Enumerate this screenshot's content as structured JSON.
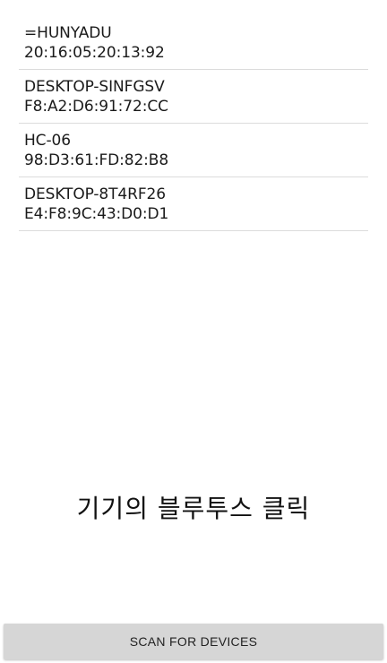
{
  "devices": [
    {
      "name": "=HUNYADU",
      "address": "20:16:05:20:13:92"
    },
    {
      "name": "DESKTOP-SINFGSV",
      "address": "F8:A2:D6:91:72:CC"
    },
    {
      "name": "HC-06",
      "address": "98:D3:61:FD:82:B8"
    },
    {
      "name": "DESKTOP-8T4RF26",
      "address": "E4:F8:9C:43:D0:D1"
    }
  ],
  "prompt_text": "기기의 블루투스 클릭",
  "scan_button_label": "SCAN FOR DEVICES",
  "colors": {
    "button_bg": "#d6d6d6",
    "divider": "#dcdcdc"
  }
}
